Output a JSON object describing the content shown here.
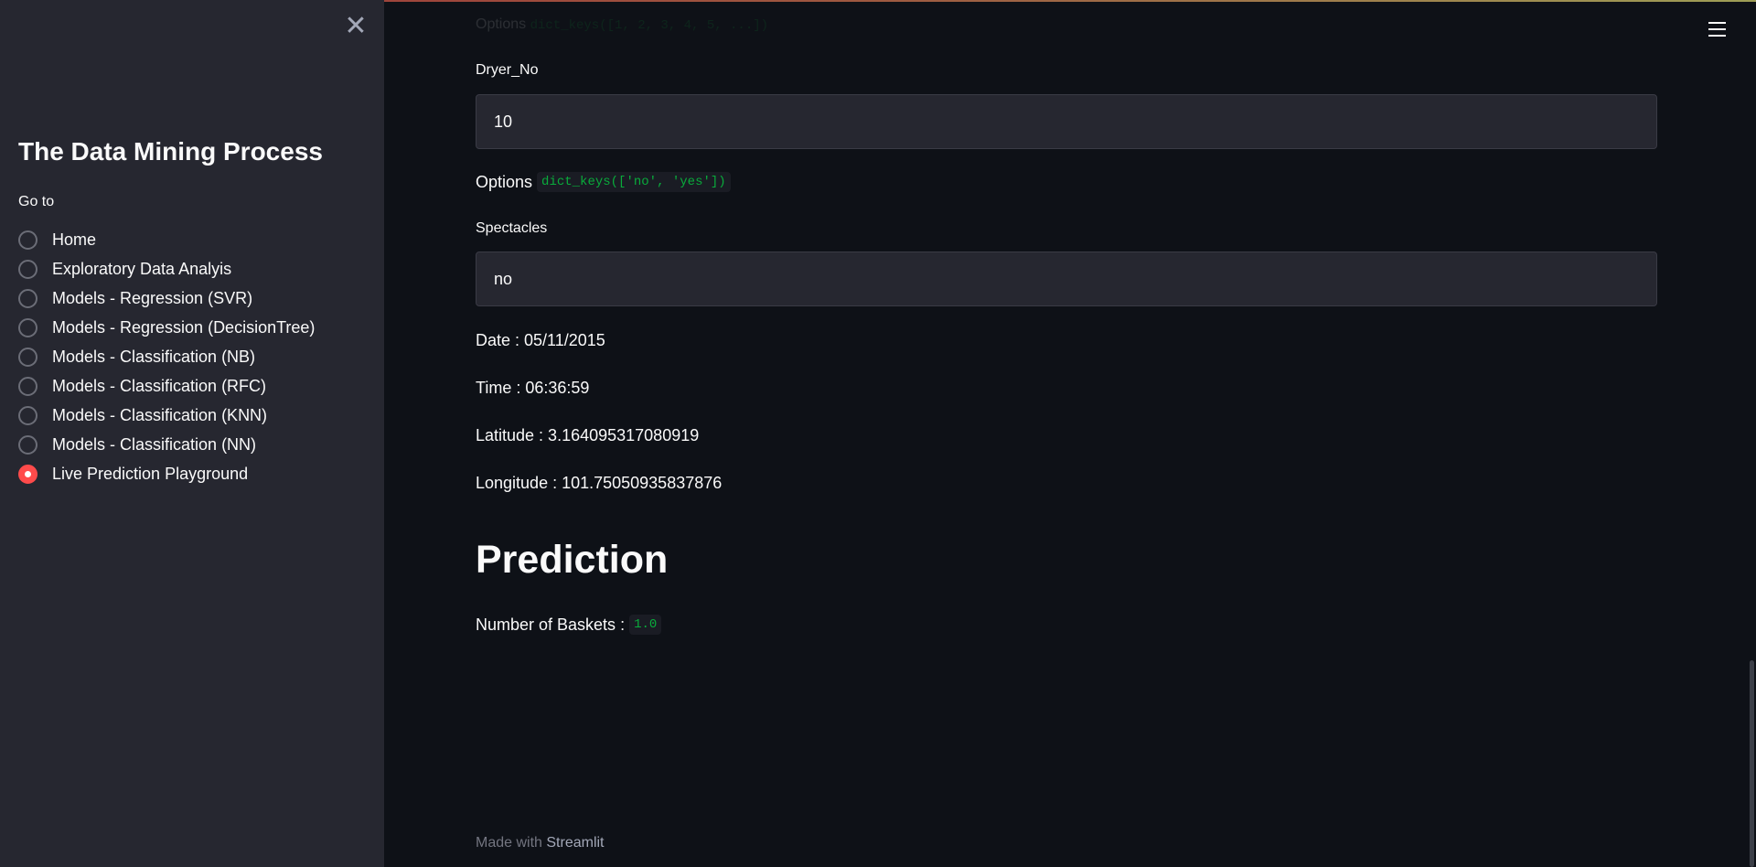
{
  "sidebar": {
    "title": "The Data Mining Process",
    "goto_label": "Go to",
    "options": [
      "Home",
      "Exploratory Data Analyis",
      "Models - Regression (SVR)",
      "Models - Regression (DecisionTree)",
      "Models - Classification (NB)",
      "Models - Classification (RFC)",
      "Models - Classification (KNN)",
      "Models - Classification (NN)",
      "Live Prediction Playground"
    ],
    "selected": "Live Prediction Playground"
  },
  "main": {
    "faded_options_label": "Options",
    "faded_options_code": "dict_keys([1, 2, 3, 4, 5, ...])",
    "dryer_label": "Dryer_No",
    "dryer_value": "10",
    "options_label": "Options",
    "options_code": "dict_keys(['no', 'yes'])",
    "spectacles_label": "Spectacles",
    "spectacles_value": "no",
    "date_text": "Date : 05/11/2015",
    "time_text": "Time : 06:36:59",
    "latitude_text": "Latitude : 3.164095317080919",
    "longitude_text": "Longitude : 101.75050935837876",
    "prediction_heading": "Prediction",
    "baskets_label": "Number of Baskets :",
    "baskets_value": "1.0"
  },
  "footer": {
    "made_with": "Made with",
    "brand": "Streamlit"
  },
  "colors": {
    "accent": "#ff4b4b",
    "background": "#0e1117",
    "sidebar": "#262730",
    "code_text": "#09ab3b"
  }
}
